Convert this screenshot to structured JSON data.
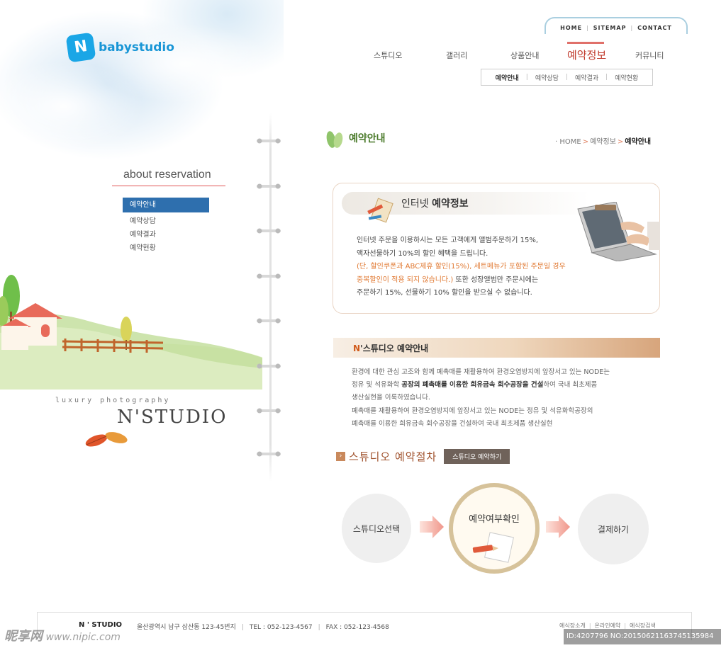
{
  "brand": {
    "logo_letter": "N",
    "name": "babystudio"
  },
  "util_nav": {
    "items": [
      "HOME",
      "SITEMAP",
      "CONTACT"
    ],
    "separator": "|"
  },
  "gnb": {
    "items": [
      "스튜디오",
      "갤러리",
      "상품안내",
      "예약정보",
      "커뮤니티"
    ],
    "active": "예약정보"
  },
  "sub_gnb": {
    "items": [
      "예약안내",
      "예약상담",
      "예약결과",
      "예약현황"
    ],
    "separator": "|"
  },
  "sidebar": {
    "heading": "about reservation",
    "items": [
      {
        "label": "예약안내",
        "active": true
      },
      {
        "label": "예약상담"
      },
      {
        "label": "예약결과"
      },
      {
        "label": "예약현황"
      }
    ]
  },
  "tagline": {
    "sub": "luxury photography",
    "main": "N'STUDIO"
  },
  "page": {
    "title": "예약안내",
    "breadcrumb": {
      "bullet": "·",
      "home": "HOME",
      "section": "예약정보",
      "current": "예약안내",
      "arrow": ">"
    }
  },
  "internet_box": {
    "title_pre": "인터넷 ",
    "title_bold": "예약정보",
    "line1": "인터넷 주문을 이용하시는 모든 고객에게 앨범주문하기 15%,",
    "line2": "액자선물하기 10%의 할인 혜택을 드립니다.",
    "line3_orange": "(단, 할인쿠폰과 ABC제휴 할인(15%), 세트메뉴가 포함된 주문일 경우",
    "line4_orange": "중복할인이 적용 되지 않습니다.)",
    "line4_rest": " 또한 성장앨범만 주문시에는",
    "line5": "주문하기 15%, 선물하기 10% 할인을 받으실 수 없습니다."
  },
  "studio_section": {
    "title_n": "N",
    "title_rest": "'스튜디오 예약안내",
    "line1": "환경에 대한 관심 고조와 함께 폐촉매를 재활용하여 환경오염방지에 앞장서고 있는 NODE는",
    "line2_pre": "정유 및 석유화학 ",
    "line2_bold": "공장의 폐촉매를 이용한 희유금속 회수공장을 건설",
    "line2_post": "하여 국내 최초제품",
    "line3": "생산실현을 이룩하였습니다.",
    "line4": "폐촉매를 재활용하여 환경오염방지에 앞장서고 있는 NODE는 정유 및 석유화학공장의",
    "line5": "폐촉매를 이용한 희유금속 회수공장을 건설하여 국내 최초제품 생산실현"
  },
  "process": {
    "arrow_glyph": "›",
    "title": "스튜디오 예약절차",
    "button": "스튜디오 예약하기",
    "steps": [
      "스튜디오선택",
      "예약여부확인",
      "결제하기"
    ]
  },
  "footer": {
    "logo": "N ' STUDIO",
    "address": "울산광역시 남구 삼산동 123-45번지",
    "tel": "TEL : 052-123-4567",
    "fax": "FAX : 052-123-4568",
    "links": [
      "예식장소개",
      "온라인예약",
      "예식장검색"
    ],
    "separator": "|"
  },
  "watermark": {
    "left_main": "昵享网",
    "left_url": " www.nipic.com",
    "right": "ID:4207796 NO:20150621163745135984"
  },
  "colors": {
    "sidebar_active": "#2e6fae",
    "gnb_active": "#c0392b",
    "highlight_orange": "#e0772f",
    "logo_blue": "#1aa6e6"
  }
}
